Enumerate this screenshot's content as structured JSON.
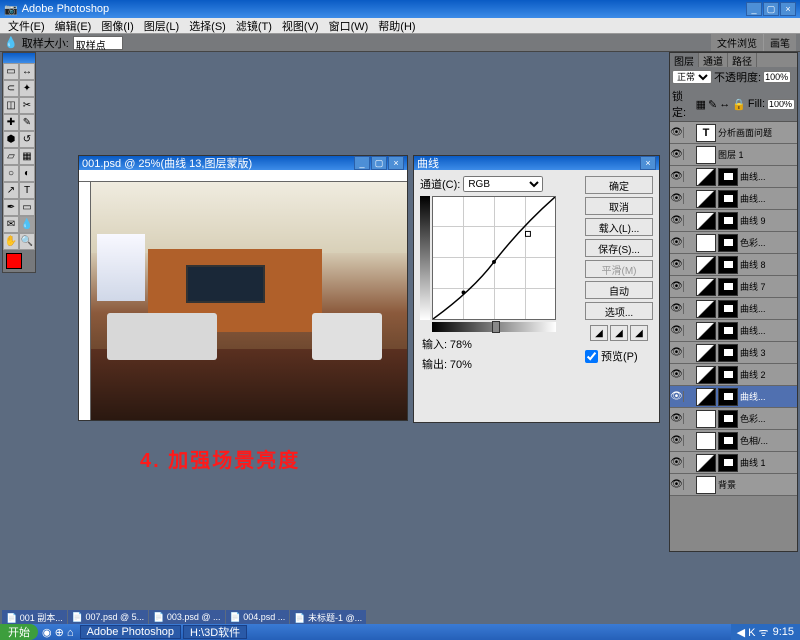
{
  "app": {
    "title": "Adobe Photoshop"
  },
  "menu": [
    "文件(E)",
    "编辑(E)",
    "图像(I)",
    "图层(L)",
    "选择(S)",
    "滤镜(T)",
    "视图(V)",
    "窗口(W)",
    "帮助(H)"
  ],
  "optbar": {
    "label": "取样大小:",
    "value": "取样点",
    "tabs": [
      "文件浏览",
      "画笔"
    ]
  },
  "doc": {
    "title": "001.psd @ 25%(曲线 13,图层蒙版)"
  },
  "caption": "4. 加强场景亮度",
  "curves": {
    "title": "曲线",
    "channel_label": "通道(C):",
    "channel": "RGB",
    "input_label": "输入:",
    "input_value": "78%",
    "output_label": "输出:",
    "output_value": "70%",
    "buttons": [
      "确定",
      "取消",
      "载入(L)...",
      "保存(S)...",
      "平滑(M)",
      "自动",
      "选项..."
    ],
    "preview": "预览(P)"
  },
  "chart_data": {
    "type": "line",
    "title": "Curves RGB",
    "xlabel": "Input",
    "ylabel": "Output",
    "xlim": [
      0,
      100
    ],
    "ylim": [
      0,
      100
    ],
    "series": [
      {
        "name": "RGB",
        "values": [
          [
            0,
            0
          ],
          [
            25,
            22
          ],
          [
            50,
            47
          ],
          [
            78,
            70
          ],
          [
            100,
            100
          ]
        ]
      }
    ]
  },
  "layers": {
    "tabs": [
      "图层",
      "通道",
      "路径"
    ],
    "blend": "正常",
    "opacity_label": "不透明度:",
    "opacity": "100%",
    "lock_label": "锁定:",
    "fill_label": "Fill:",
    "fill": "100%",
    "items": [
      {
        "name": "分析画面问题",
        "type": "text"
      },
      {
        "name": "图层 1",
        "type": "img"
      },
      {
        "name": "曲线...",
        "type": "curve"
      },
      {
        "name": "曲线...",
        "type": "curve"
      },
      {
        "name": "曲线 9",
        "type": "curve"
      },
      {
        "name": "色彩...",
        "type": "adj"
      },
      {
        "name": "曲线 8",
        "type": "curve"
      },
      {
        "name": "曲线 7",
        "type": "curve"
      },
      {
        "name": "曲线...",
        "type": "curve"
      },
      {
        "name": "曲线...",
        "type": "curve"
      },
      {
        "name": "曲线 3",
        "type": "curve"
      },
      {
        "name": "曲线 2",
        "type": "curve"
      },
      {
        "name": "曲线...",
        "type": "curve",
        "sel": true
      },
      {
        "name": "色彩...",
        "type": "adj"
      },
      {
        "name": "色相/...",
        "type": "adj"
      },
      {
        "name": "曲线 1",
        "type": "curve"
      },
      {
        "name": "背景",
        "type": "img"
      }
    ]
  },
  "wintabs": [
    "001 副本...",
    "007.psd @ 5...",
    "003.psd @ ...",
    "004.psd ...",
    "未标题-1 @..."
  ],
  "taskbar": {
    "start": "开始",
    "items": [
      "Adobe Photoshop",
      "H:\\3D软件"
    ],
    "time": "9:15"
  }
}
